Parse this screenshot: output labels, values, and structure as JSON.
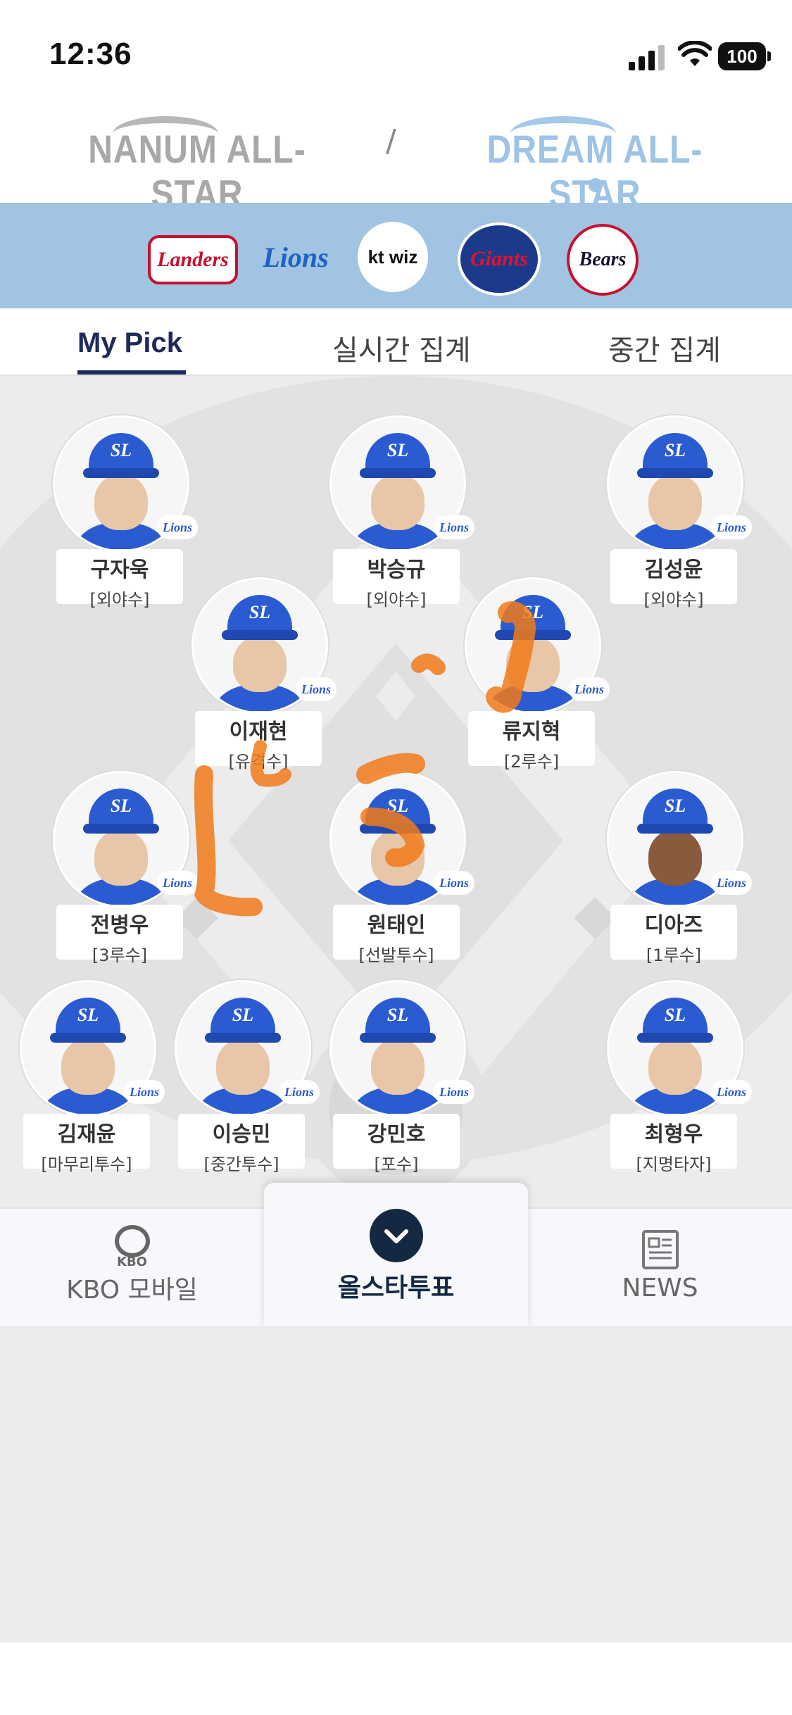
{
  "status_bar": {
    "time": "12:36",
    "battery": "100"
  },
  "leagues": {
    "left": "NANUM ALL-STAR",
    "separator": "/",
    "right": "DREAM ALL-STAR",
    "selected": "DREAM ALL-STAR"
  },
  "teams": [
    {
      "label": "Landers",
      "icon": "ssg-landers-logo",
      "color": "#c8102e"
    },
    {
      "label": "Lions",
      "icon": "samsung-lions-logo",
      "color": "#1d62c4"
    },
    {
      "label": "kt wiz",
      "icon": "kt-wiz-logo",
      "color": "#111111"
    },
    {
      "label": "Giants",
      "icon": "lotte-giants-logo",
      "color": "#d0112b"
    },
    {
      "label": "Bears",
      "icon": "doosan-bears-logo",
      "color": "#131230"
    }
  ],
  "tabs": [
    {
      "label": "My Pick",
      "active": true
    },
    {
      "label": "실시간 집계",
      "active": false
    },
    {
      "label": "중간 집계",
      "active": false
    }
  ],
  "players": [
    {
      "name": "구자욱",
      "position": "[외야수]",
      "team": "Lions"
    },
    {
      "name": "박승규",
      "position": "[외야수]",
      "team": "Lions"
    },
    {
      "name": "김성윤",
      "position": "[외야수]",
      "team": "Lions"
    },
    {
      "name": "이재현",
      "position": "[유격수]",
      "team": "Lions"
    },
    {
      "name": "류지혁",
      "position": "[2루수]",
      "team": "Lions"
    },
    {
      "name": "전병우",
      "position": "[3루수]",
      "team": "Lions"
    },
    {
      "name": "원태인",
      "position": "[선발투수]",
      "team": "Lions"
    },
    {
      "name": "디아즈",
      "position": "[1루수]",
      "team": "Lions"
    },
    {
      "name": "김재윤",
      "position": "[마무리투수]",
      "team": "Lions"
    },
    {
      "name": "이승민",
      "position": "[중간투수]",
      "team": "Lions"
    },
    {
      "name": "강민호",
      "position": "[포수]",
      "team": "Lions"
    },
    {
      "name": "최형우",
      "position": "[지명타자]",
      "team": "Lions"
    }
  ],
  "bottom_nav": [
    {
      "label": "KBO 모바일",
      "icon": "kbo-logo-icon"
    },
    {
      "label": "올스타투표",
      "icon": "chevron-down-icon",
      "active": true
    },
    {
      "label": "NEWS",
      "icon": "newspaper-icon"
    }
  ],
  "colors": {
    "team_bar": "#a1c4e2",
    "accent": "#1f2a5c",
    "cap_blue": "#2a5bd1",
    "annotation": "#f07a1a"
  }
}
